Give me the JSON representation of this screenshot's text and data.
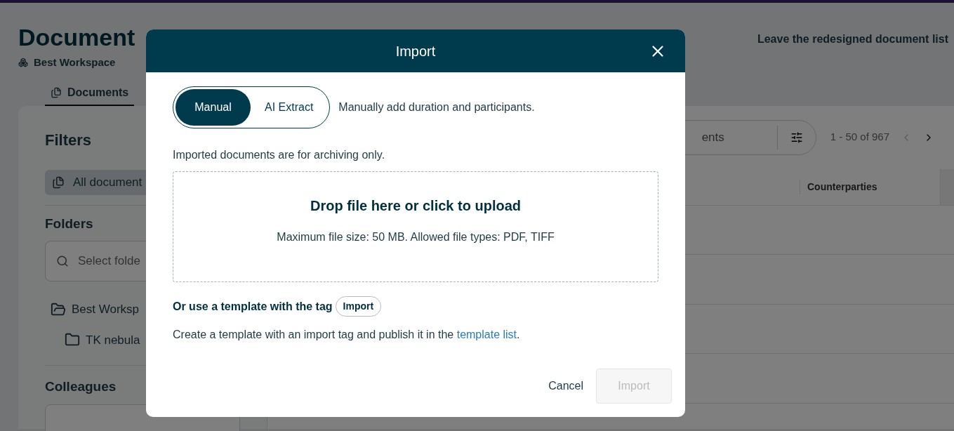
{
  "page": {
    "title": "Document",
    "workspace": "Best Workspace",
    "leave_link": "Leave the redesigned document list"
  },
  "tabs": [
    {
      "label": "Documents",
      "selected": true
    }
  ],
  "filters": {
    "title": "Filters",
    "all_documents": {
      "label": "All document",
      "selected": true
    },
    "folders_title": "Folders",
    "folder_search": {
      "placeholder": "Select folde"
    },
    "folders": [
      {
        "name": "Best Worksp",
        "kind": "workspace",
        "children": [
          {
            "name": "TK nebula",
            "kind": "folder"
          }
        ]
      }
    ],
    "colleagues_title": "Colleagues"
  },
  "list": {
    "search": {
      "placeholder": "ents"
    },
    "pagination": "1 - 50 of 967",
    "prev_disabled": true,
    "next_disabled": false,
    "columns": [
      "Counterparties"
    ]
  },
  "dialog": {
    "title": "Import",
    "modes": [
      {
        "label": "Manual",
        "selected": true
      },
      {
        "label": "AI Extract",
        "selected": false
      }
    ],
    "mode_hint": "Manually add duration and participants.",
    "note": "Imported documents are for archiving only.",
    "dropzone": {
      "title": "Drop file here or click to upload",
      "hint": "Maximum file size: 50 MB. Allowed file types: PDF, TIFF"
    },
    "template_heading": "Or use a template with the tag",
    "tag": "Import",
    "template_text": "Create a template with an import tag and publish it in the",
    "template_link": "template list",
    "template_end": ".",
    "cancel": "Cancel",
    "submit": {
      "label": "Import",
      "disabled": true
    }
  }
}
